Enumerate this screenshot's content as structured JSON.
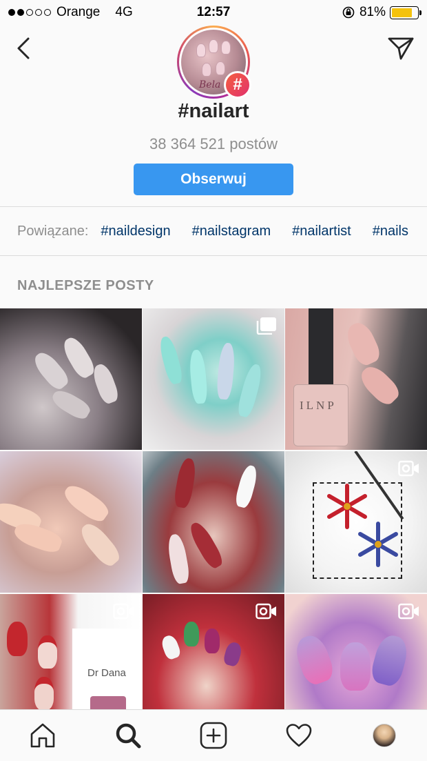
{
  "status_bar": {
    "carrier": "Orange",
    "network": "4G",
    "time": "12:57",
    "battery_percent": "81%",
    "battery_level": 0.81,
    "signal_bars_filled": 2,
    "signal_bars_total": 5
  },
  "header": {
    "back_icon": "chevron-left-icon",
    "send_icon": "paper-plane-icon",
    "hashtag_badge": "#",
    "avatar_caption": "Bela"
  },
  "hashtag": {
    "title": "#nailart",
    "post_count": "38 364 521 postów",
    "follow_label": "Obserwuj"
  },
  "related": {
    "label": "Powiązane:",
    "tags": [
      "#naildesign",
      "#nailstagram",
      "#nailartist",
      "#nails"
    ]
  },
  "top_posts": {
    "title": "NAJLEPSZE POSTY",
    "items": [
      {
        "type": "photo",
        "icon": ""
      },
      {
        "type": "carousel",
        "icon": "multiple-photos-icon"
      },
      {
        "type": "photo",
        "icon": ""
      },
      {
        "type": "photo",
        "icon": ""
      },
      {
        "type": "photo",
        "icon": ""
      },
      {
        "type": "video",
        "icon": "video-camera-icon"
      },
      {
        "type": "video",
        "icon": "video-camera-icon"
      },
      {
        "type": "video",
        "icon": "video-camera-icon"
      },
      {
        "type": "video",
        "icon": "video-camera-icon"
      }
    ],
    "image_texts": {
      "bottle_brand": "ILNP",
      "dr_dana": "Dr Dana"
    }
  },
  "tabbar": {
    "items": [
      "home-icon",
      "search-icon",
      "new-post-icon",
      "activity-heart-icon",
      "profile-avatar"
    ],
    "active": "search-icon"
  },
  "colors": {
    "accent": "#3897f0",
    "link": "#003569",
    "muted": "#8e8e8e",
    "battery": "#f4c20d"
  }
}
